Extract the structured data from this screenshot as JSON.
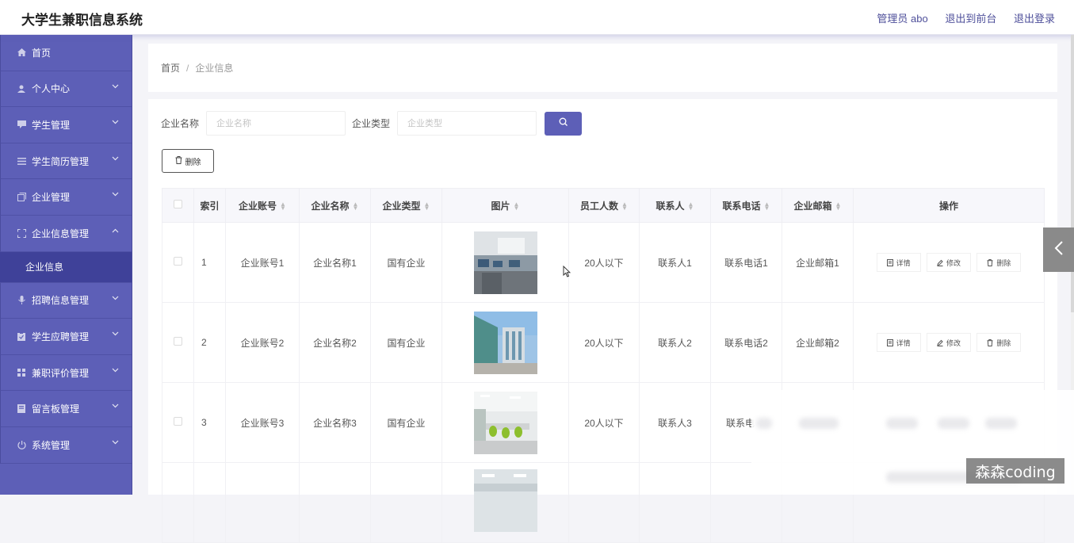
{
  "header": {
    "app_title": "大学生兼职信息系统",
    "admin_label": "管理员 abo",
    "front_link": "退出到前台",
    "logout_link": "退出登录"
  },
  "sidebar": {
    "items": [
      {
        "label": "首页",
        "icon": "home-icon",
        "has_chevron": false
      },
      {
        "label": "个人中心",
        "icon": "user-icon",
        "has_chevron": true
      },
      {
        "label": "学生管理",
        "icon": "chat-icon",
        "has_chevron": true
      },
      {
        "label": "学生简历管理",
        "icon": "list-icon",
        "has_chevron": true
      },
      {
        "label": "企业管理",
        "icon": "copy-icon",
        "has_chevron": true
      },
      {
        "label": "企业信息管理",
        "icon": "fullscreen-icon",
        "has_chevron": true,
        "expanded": true
      },
      {
        "label": "招聘信息管理",
        "icon": "mic-icon",
        "has_chevron": true
      },
      {
        "label": "学生应聘管理",
        "icon": "clipboard-icon",
        "has_chevron": true
      },
      {
        "label": "兼职评价管理",
        "icon": "grid-icon",
        "has_chevron": true
      },
      {
        "label": "留言板管理",
        "icon": "book-icon",
        "has_chevron": true
      },
      {
        "label": "系统管理",
        "icon": "power-icon",
        "has_chevron": true
      }
    ],
    "subitem": "企业信息"
  },
  "breadcrumb": {
    "home": "首页",
    "separator": "/",
    "current": "企业信息"
  },
  "search": {
    "name_label": "企业名称",
    "name_placeholder": "企业名称",
    "type_label": "企业类型",
    "type_placeholder": "企业类型"
  },
  "toolbar": {
    "delete_label": "删除"
  },
  "table": {
    "headers": {
      "index": "索引",
      "account": "企业账号",
      "name": "企业名称",
      "type": "企业类型",
      "image": "图片",
      "staff": "员工人数",
      "contact": "联系人",
      "phone": "联系电话",
      "email": "企业邮箱",
      "actions": "操作"
    },
    "rows": [
      {
        "index": "1",
        "account": "企业账号1",
        "name": "企业名称1",
        "type": "国有企业",
        "image": "office-interior-photo",
        "staff": "20人以下",
        "contact": "联系人1",
        "phone": "联系电话1",
        "email": "企业邮箱1"
      },
      {
        "index": "2",
        "account": "企业账号2",
        "name": "企业名称2",
        "type": "国有企业",
        "image": "office-building-photo",
        "staff": "20人以下",
        "contact": "联系人2",
        "phone": "联系电话2",
        "email": "企业邮箱2"
      },
      {
        "index": "3",
        "account": "企业账号3",
        "name": "企业名称3",
        "type": "国有企业",
        "image": "meeting-room-photo",
        "staff": "20人以下",
        "contact": "联系人3",
        "phone": "联系电",
        "email": ""
      }
    ],
    "row_actions": {
      "detail": "详情",
      "edit": "修改",
      "delete": "删除"
    }
  },
  "watermark": "森森coding",
  "colors": {
    "accent": "#5d5fb7",
    "sidebar_active": "#3f4199"
  }
}
